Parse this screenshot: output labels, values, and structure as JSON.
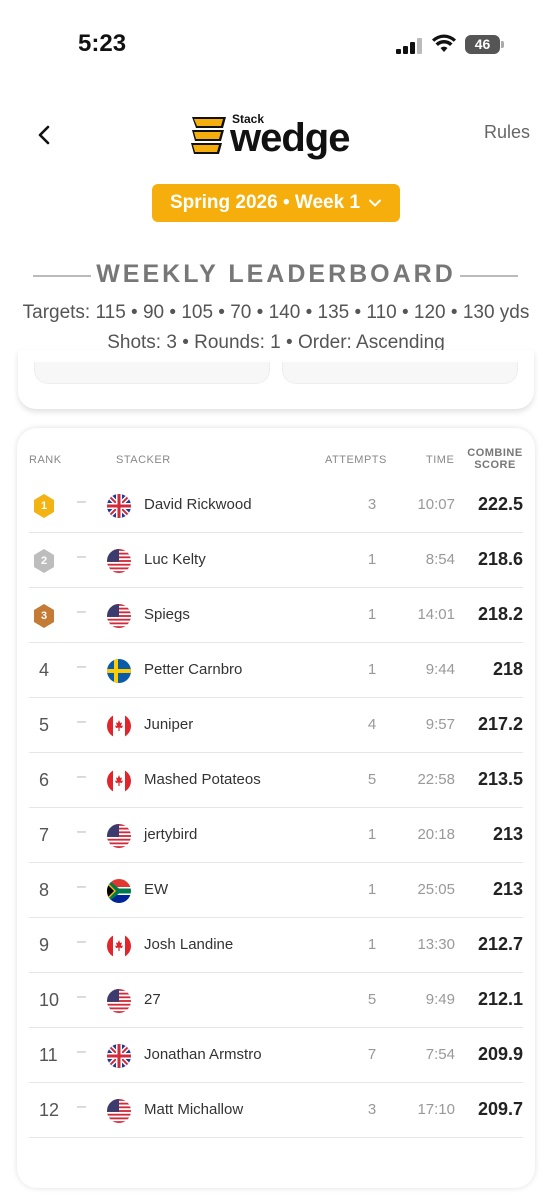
{
  "status_bar": {
    "time": "5:23",
    "battery": "46",
    "icons": [
      "signal-icon",
      "wifi-icon",
      "battery-icon"
    ]
  },
  "header": {
    "logo_small": "Stack",
    "logo_large": "wedge",
    "rules": "Rules",
    "back_icon": "chevron-left-icon"
  },
  "season": {
    "label": "Spring 2026 • Week 1",
    "icon": "chevron-down-icon"
  },
  "leaderboard": {
    "title": "WEEKLY LEADERBOARD",
    "targets": "Targets: 115 • 90 • 105 • 70 • 140 • 135 • 110 • 120 • 130 yds",
    "shots": "Shots: 3 • Rounds: 1 • Order: Ascending"
  },
  "table": {
    "headers": {
      "rank": "RANK",
      "stacker": "STACKER",
      "attempts": "ATTEMPTS",
      "time": "TIME",
      "score_line1": "COMBINE",
      "score_line2": "SCORE"
    },
    "medal_colors": {
      "gold": "#f2b313",
      "silver": "#bdbdbd",
      "bronze": "#c47b35"
    },
    "rows": [
      {
        "rank": "1",
        "medal": "gold",
        "change": "–",
        "flag": "uk",
        "name": "David Rickwood",
        "attempts": "3",
        "time": "10:07",
        "score": "222.5"
      },
      {
        "rank": "2",
        "medal": "silver",
        "change": "–",
        "flag": "us",
        "name": "Luc Kelty",
        "attempts": "1",
        "time": "8:54",
        "score": "218.6"
      },
      {
        "rank": "3",
        "medal": "bronze",
        "change": "–",
        "flag": "us",
        "name": "Spiegs",
        "attempts": "1",
        "time": "14:01",
        "score": "218.2"
      },
      {
        "rank": "4",
        "medal": "",
        "change": "–",
        "flag": "se",
        "name": "Petter Carnbro",
        "attempts": "1",
        "time": "9:44",
        "score": "218"
      },
      {
        "rank": "5",
        "medal": "",
        "change": "–",
        "flag": "ca",
        "name": "Juniper",
        "attempts": "4",
        "time": "9:57",
        "score": "217.2"
      },
      {
        "rank": "6",
        "medal": "",
        "change": "–",
        "flag": "ca",
        "name": "Mashed Potateos",
        "attempts": "5",
        "time": "22:58",
        "score": "213.5"
      },
      {
        "rank": "7",
        "medal": "",
        "change": "–",
        "flag": "us",
        "name": "jertybird",
        "attempts": "1",
        "time": "20:18",
        "score": "213"
      },
      {
        "rank": "8",
        "medal": "",
        "change": "–",
        "flag": "za",
        "name": "EW",
        "attempts": "1",
        "time": "25:05",
        "score": "213"
      },
      {
        "rank": "9",
        "medal": "",
        "change": "–",
        "flag": "ca",
        "name": "Josh Landine",
        "attempts": "1",
        "time": "13:30",
        "score": "212.7"
      },
      {
        "rank": "10",
        "medal": "",
        "change": "–",
        "flag": "us",
        "name": "27",
        "attempts": "5",
        "time": "9:49",
        "score": "212.1"
      },
      {
        "rank": "11",
        "medal": "",
        "change": "–",
        "flag": "uk",
        "name": "Jonathan Armstro",
        "attempts": "7",
        "time": "7:54",
        "score": "209.9"
      },
      {
        "rank": "12",
        "medal": "",
        "change": "–",
        "flag": "us",
        "name": "Matt Michallow",
        "attempts": "3",
        "time": "17:10",
        "score": "209.7"
      }
    ]
  },
  "colors": {
    "accent": "#f5ae0c",
    "text_muted": "#999999"
  }
}
